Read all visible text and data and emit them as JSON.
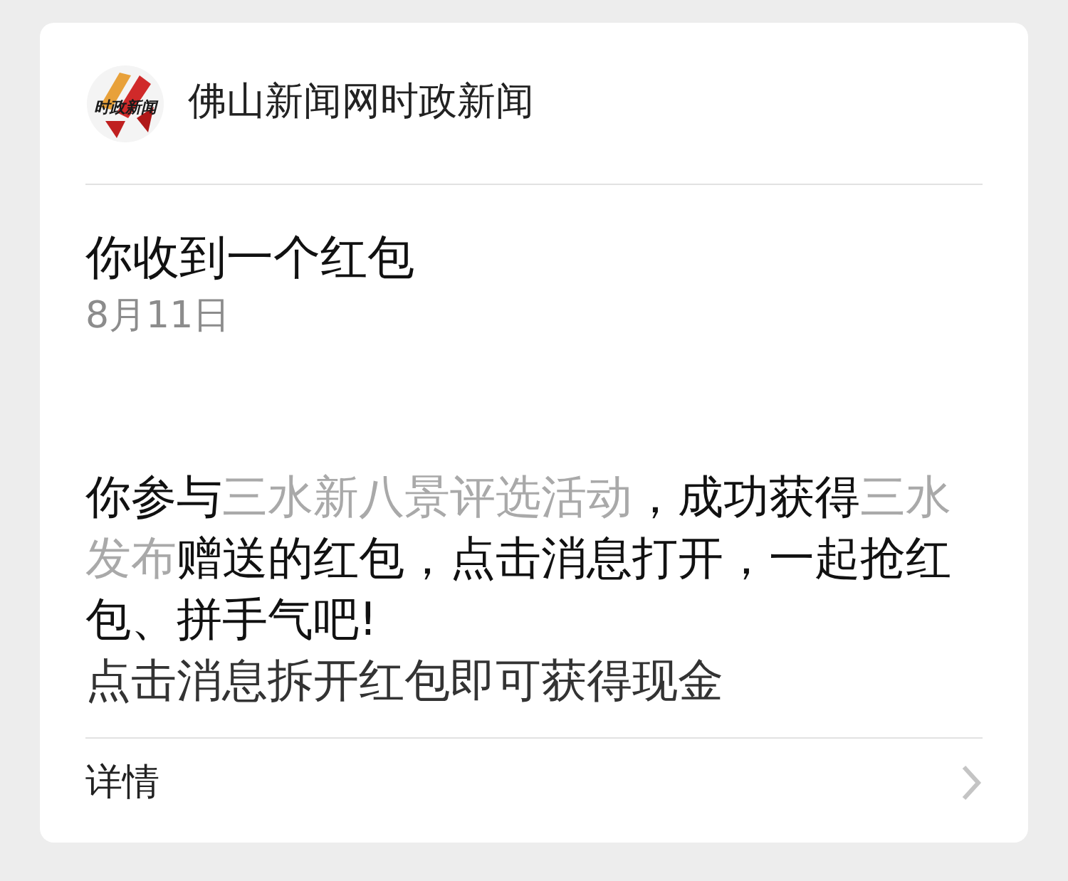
{
  "header": {
    "logo_text": "时政新闻",
    "account_name": "佛山新闻网时政新闻"
  },
  "message": {
    "title": "你收到一个红包",
    "date": "8月11日",
    "body": [
      {
        "kind": "plain",
        "text": "你参与"
      },
      {
        "kind": "highlight",
        "text": "三水新八景评选活动"
      },
      {
        "kind": "plain",
        "text": "，成功获得"
      },
      {
        "kind": "highlight",
        "text": "三水发布"
      },
      {
        "kind": "plain",
        "text": "赠送的红包，点击消息打开，一起抢红包、拼手气吧!"
      }
    ],
    "note": "点击消息拆开红包即可获得现金"
  },
  "footer": {
    "link": "详情"
  }
}
